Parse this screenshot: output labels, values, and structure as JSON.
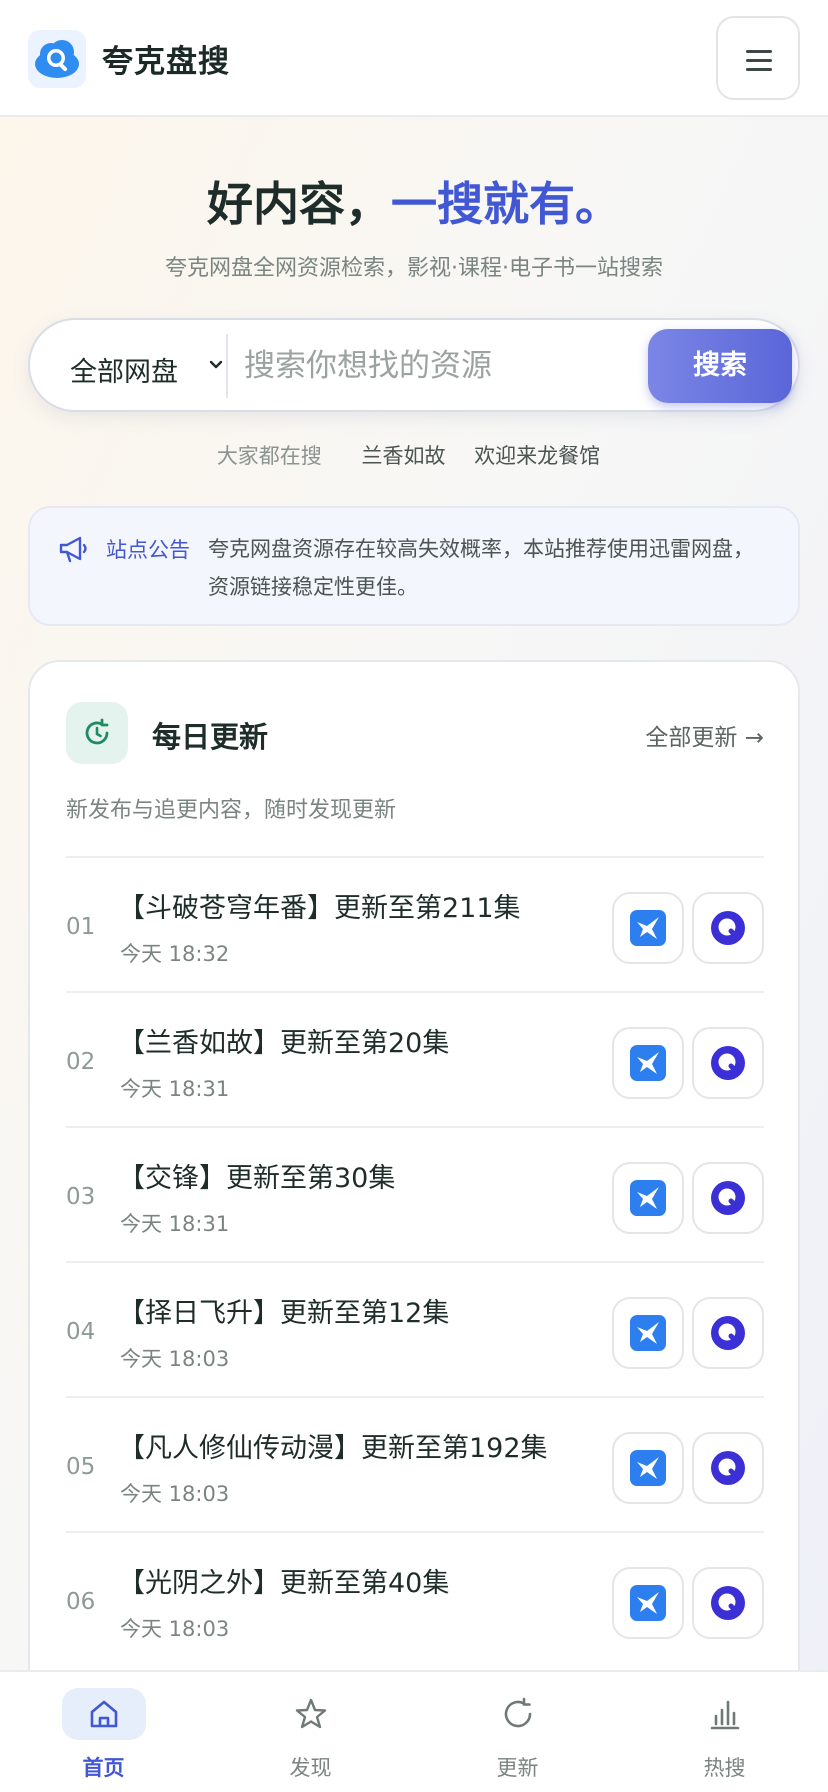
{
  "header": {
    "app_name": "夸克盘搜",
    "logo_icon": "cloud-search-logo-icon",
    "menu_icon": "hamburger-menu-icon"
  },
  "hero": {
    "title_main": "好内容，",
    "title_accent": "一搜就有。",
    "subtitle": "夸克网盘全网资源检索，影视·课程·电子书一站搜索",
    "accent_color": "#4157d4"
  },
  "search": {
    "scope_value": "全部网盘",
    "placeholder": "搜索你想找的资源",
    "button_label": "搜索"
  },
  "hot_search": {
    "label": "大家都在搜",
    "tags": [
      "兰香如故",
      "欢迎来龙餐馆"
    ]
  },
  "notice": {
    "label": "站点公告",
    "text": "夸克网盘资源存在较高失效概率，本站推荐使用迅雷网盘，资源链接稳定性更佳。",
    "icon": "megaphone-icon"
  },
  "daily": {
    "title": "每日更新",
    "link_label": "全部更新 →",
    "subtitle": "新发布与追更内容，随时发现更新",
    "icon": "refresh-icon",
    "items": [
      {
        "num": "01",
        "title": "【斗破苍穹年番】更新至第211集",
        "time": "今天 18:32"
      },
      {
        "num": "02",
        "title": "【兰香如故】更新至第20集",
        "time": "今天 18:31"
      },
      {
        "num": "03",
        "title": "【交锋】更新至第30集",
        "time": "今天 18:31"
      },
      {
        "num": "04",
        "title": "【择日飞升】更新至第12集",
        "time": "今天 18:03"
      },
      {
        "num": "05",
        "title": "【凡人修仙传动漫】更新至第192集",
        "time": "今天 18:03"
      },
      {
        "num": "06",
        "title": "【光阴之外】更新至第40集",
        "time": "今天 18:03"
      }
    ],
    "action_icons": [
      "xunlei-bird-icon",
      "quark-circle-icon"
    ]
  },
  "bottom_nav": {
    "items": [
      {
        "label": "首页",
        "icon": "home-icon",
        "active": true
      },
      {
        "label": "发现",
        "icon": "star-icon",
        "active": false
      },
      {
        "label": "更新",
        "icon": "refresh-icon",
        "active": false
      },
      {
        "label": "热搜",
        "icon": "bar-chart-icon",
        "active": false
      }
    ]
  }
}
